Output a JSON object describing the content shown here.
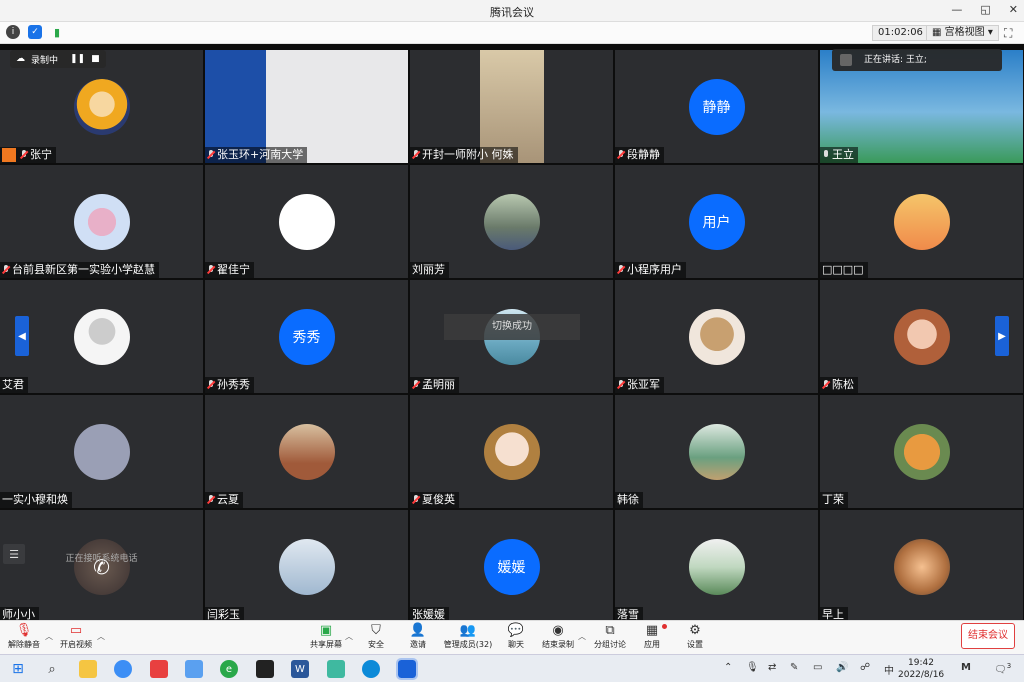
{
  "window": {
    "title": "腾讯会议",
    "minimize": "—",
    "restore": "◱",
    "close": "✕"
  },
  "infobar": {
    "timer": "01:02:06",
    "view_label": "宫格视图",
    "view_caret": "▾"
  },
  "recording": {
    "label": "录制中"
  },
  "speaking": {
    "label": "正在讲话: 王立;"
  },
  "toast": {
    "text": "切换成功"
  },
  "calling_text": "正在接听系统电话",
  "tiles": [
    {
      "name": "张宁",
      "avatar": "cartoon-girl"
    },
    {
      "name": "张玉环+河南大学",
      "avatar": "video-room"
    },
    {
      "name": "开封一师附小 何姝",
      "avatar": "video-bookshelf"
    },
    {
      "name": "段静静",
      "avatar": "text",
      "avatar_text": "静静"
    },
    {
      "name": "王立",
      "avatar": "video-man"
    },
    {
      "name": "台前县新区第一实验小学赵慧",
      "avatar": "family-cartoon"
    },
    {
      "name": "翟佳宁",
      "avatar": "white-doodle"
    },
    {
      "name": "刘丽芳",
      "avatar": "couple-photo"
    },
    {
      "name": "小程序用户",
      "avatar": "text",
      "avatar_text": "用户"
    },
    {
      "name": "□□□□",
      "avatar": "sunset-text"
    },
    {
      "name": "艾君",
      "avatar": "girl-white"
    },
    {
      "name": "孙秀秀",
      "avatar": "text",
      "avatar_text": "秀秀"
    },
    {
      "name": "孟明丽",
      "avatar": "blue-landscape"
    },
    {
      "name": "张亚军",
      "avatar": "hair-back"
    },
    {
      "name": "陈松",
      "avatar": "woman-portrait"
    },
    {
      "name": "一实小穆和焕",
      "avatar": "sketch-girl"
    },
    {
      "name": "云夏",
      "avatar": "cat-photo"
    },
    {
      "name": "夏俊英",
      "avatar": "anime-boy"
    },
    {
      "name": "韩徐",
      "avatar": "red-dress"
    },
    {
      "name": "丁荣",
      "avatar": "shiba-dog"
    },
    {
      "name": "师小小",
      "avatar": "phone-call"
    },
    {
      "name": "闫彩玉",
      "avatar": "kids-photo"
    },
    {
      "name": "张媛媛",
      "avatar": "text",
      "avatar_text": "媛媛"
    },
    {
      "name": "落雪",
      "avatar": "flower-hand"
    },
    {
      "name": "早上",
      "avatar": "bokeh"
    }
  ],
  "toolbar": {
    "unmute": "解除静音",
    "start_video": "开启视频",
    "share_screen": "共享屏幕",
    "security": "安全",
    "invite": "邀请",
    "manage_members": "管理成员(32)",
    "chat": "聊天",
    "end_recording": "结束录制",
    "breakout": "分组讨论",
    "apps": "应用",
    "settings": "设置",
    "end_meeting": "结束会议"
  },
  "taskbar": {
    "time": "19:42",
    "date": "2022/8/16",
    "ime": "中",
    "notify_count": "3"
  },
  "colors": {
    "accent": "#0a6cff",
    "end": "#e03030",
    "tile": "#2c2d30"
  }
}
